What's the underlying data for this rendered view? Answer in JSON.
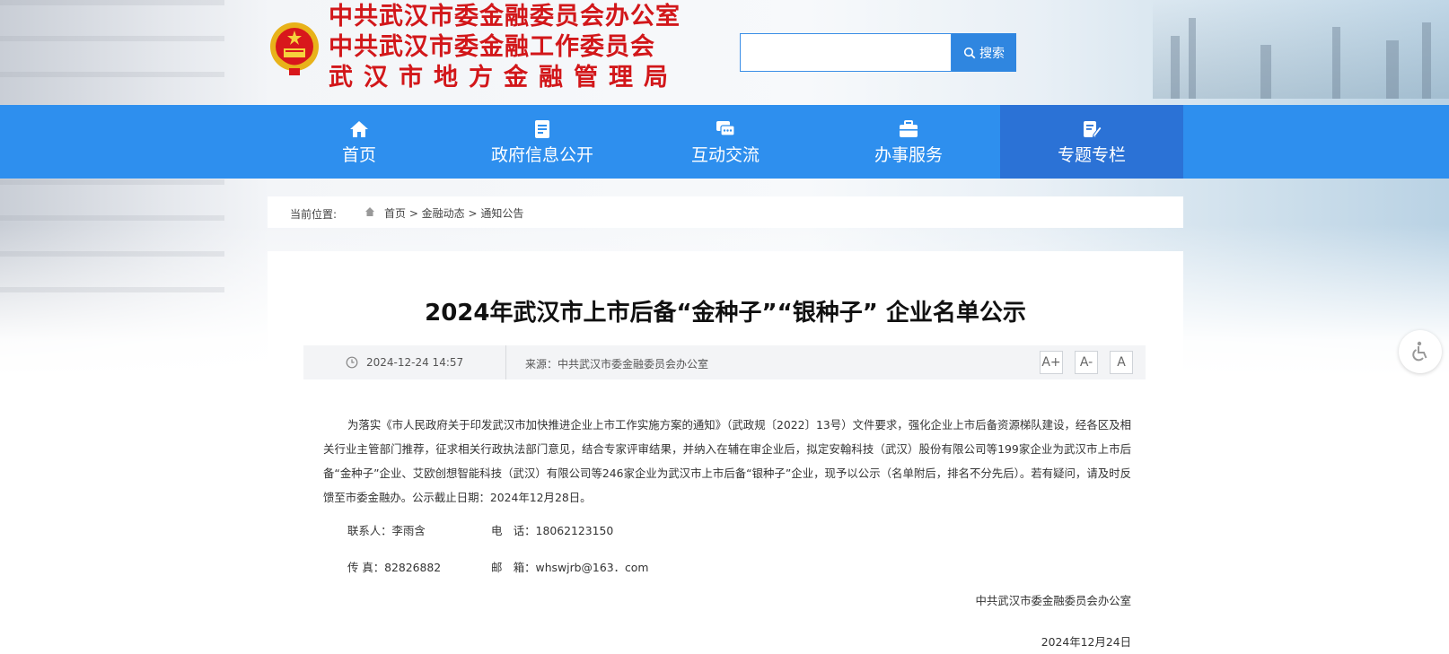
{
  "header": {
    "title_lines": [
      "中共武汉市委金融委员会办公室",
      "中共武汉市委金融工作委员会",
      "武汉市地方金融管理局"
    ],
    "search": {
      "value": "",
      "placeholder": "",
      "button_label": "搜索"
    }
  },
  "nav": {
    "items": [
      {
        "label": "首页",
        "icon": "home-icon"
      },
      {
        "label": "政府信息公开",
        "icon": "document-icon"
      },
      {
        "label": "互动交流",
        "icon": "chat-icon"
      },
      {
        "label": "办事服务",
        "icon": "briefcase-icon"
      },
      {
        "label": "专题专栏",
        "icon": "edit-icon",
        "active": true
      }
    ]
  },
  "breadcrumb": {
    "prefix": "当前位置:",
    "path": "首页 > 金融动态 > 通知公告"
  },
  "article": {
    "title": "2024年武汉市上市后备“金种子”“银种子” 企业名单公示",
    "date": "2024-12-24 14:57",
    "source": "来源：中共武汉市委金融委员会办公室",
    "font_sizes": [
      "A+",
      "A-",
      "A"
    ],
    "paragraph": "为落实《市人民政府关于印发武汉市加快推进企业上市工作实施方案的通知》（武政规〔2022〕13号）文件要求，强化企业上市后备资源梯队建设，经各区及相关行业主管部门推荐，征求相关行政执法部门意见，结合专家评审结果，并纳入在辅在审企业后，拟定安翰科技（武汉）股份有限公司等199家企业为武汉市上市后备“金种子”企业、艾欧创想智能科技（武汉）有限公司等246家企业为武汉市上市后备“银种子”企业，现予以公示（名单附后，排名不分先后）。若有疑问，请及时反馈至市委金融办。公示截止日期：2024年12月28日。",
    "contacts": {
      "person_label": "联系人：李雨含",
      "phone_label": "电　话：18062123150",
      "fax_label": "传 真：82826882",
      "email_label": "邮　箱：whswjrb@163．com"
    },
    "signature": "中共武汉市委金融委员会办公室",
    "sign_date": "2024年12月24日"
  },
  "colors": {
    "nav_bg": "#2e8fee",
    "nav_active": "#2b72d6",
    "title_red": "#d2171a",
    "search_btn": "#2f86e0"
  },
  "accessibility_icon": "wheelchair-icon"
}
